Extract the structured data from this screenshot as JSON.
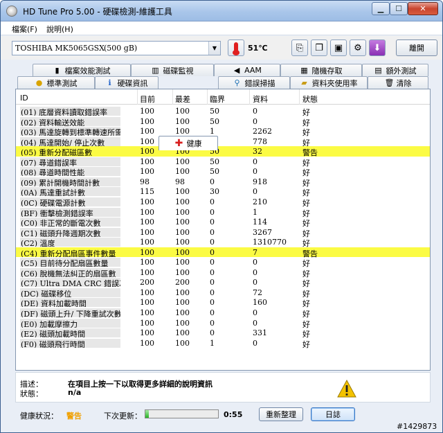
{
  "window": {
    "title": "HD Tune Pro  5.00 - 硬碟檢測-維護工具"
  },
  "menu": {
    "file": "檔案(F)",
    "help": "說明(H)"
  },
  "toolbar": {
    "drive_name": "TOSHIBA MK5065GSX",
    "drive_size": "(500 gB)",
    "temperature": "51℃",
    "exit_label": "離開"
  },
  "tabs_top": [
    {
      "label": "檔案效能測試",
      "icon": "file-benchmark-icon"
    },
    {
      "label": "磁碟監視",
      "icon": "disk-monitor-icon"
    },
    {
      "label": "AAM",
      "icon": "speaker-icon"
    },
    {
      "label": "隨機存取",
      "icon": "random-access-icon"
    },
    {
      "label": "額外測試",
      "icon": "extra-tests-icon"
    }
  ],
  "tabs_bottom": [
    {
      "label": "標準測試",
      "icon": "benchmark-icon"
    },
    {
      "label": "硬碟資訊",
      "icon": "info-icon"
    },
    {
      "label": "健康",
      "icon": "health-cross-icon"
    },
    {
      "label": "錯誤掃描",
      "icon": "error-scan-icon"
    },
    {
      "label": "資料夾使用率",
      "icon": "folder-usage-icon"
    },
    {
      "label": "清除",
      "icon": "erase-icon"
    }
  ],
  "grid": {
    "headers": [
      "ID",
      "目前",
      "最差",
      "臨界",
      "資料",
      "狀態"
    ],
    "rows": [
      {
        "id": "(01) 底層資料讀取錯誤率",
        "cur": "100",
        "worst": "100",
        "thr": "50",
        "data": "0",
        "status": "好"
      },
      {
        "id": "(02) 資料輸送效能",
        "cur": "100",
        "worst": "100",
        "thr": "50",
        "data": "0",
        "status": "好"
      },
      {
        "id": "(03) 馬達旋轉到標準轉速所需時...",
        "cur": "100",
        "worst": "100",
        "thr": "1",
        "data": "2262",
        "status": "好"
      },
      {
        "id": "(04) 馬達開始/ 停止次數",
        "cur": "100",
        "worst": "100",
        "thr": "0",
        "data": "778",
        "status": "好"
      },
      {
        "id": "(05) 重新分配磁區數",
        "cur": "100",
        "worst": "100",
        "thr": "50",
        "data": "32",
        "status": "警告",
        "warn": true
      },
      {
        "id": "(07) 尋道錯誤率",
        "cur": "100",
        "worst": "100",
        "thr": "50",
        "data": "0",
        "status": "好"
      },
      {
        "id": "(08) 尋道時間性能",
        "cur": "100",
        "worst": "100",
        "thr": "50",
        "data": "0",
        "status": "好"
      },
      {
        "id": "(09) 累計開機時間計數",
        "cur": "98",
        "worst": "98",
        "thr": "0",
        "data": "918",
        "status": "好"
      },
      {
        "id": "(0A) 馬達重試計數",
        "cur": "115",
        "worst": "100",
        "thr": "30",
        "data": "0",
        "status": "好"
      },
      {
        "id": "(0C) 硬碟電源計數",
        "cur": "100",
        "worst": "100",
        "thr": "0",
        "data": "210",
        "status": "好"
      },
      {
        "id": "(BF) 衝擊檢測錯誤率",
        "cur": "100",
        "worst": "100",
        "thr": "0",
        "data": "1",
        "status": "好"
      },
      {
        "id": "(C0) 非正常的斷電次數",
        "cur": "100",
        "worst": "100",
        "thr": "0",
        "data": "114",
        "status": "好"
      },
      {
        "id": "(C1) 磁頭升降週期次數",
        "cur": "100",
        "worst": "100",
        "thr": "0",
        "data": "3267",
        "status": "好"
      },
      {
        "id": "(C2) 溫度",
        "cur": "100",
        "worst": "100",
        "thr": "0",
        "data": "1310770",
        "status": "好"
      },
      {
        "id": "(C4) 重新分配扇區事件數量",
        "cur": "100",
        "worst": "100",
        "thr": "0",
        "data": "7",
        "status": "警告",
        "warn": true
      },
      {
        "id": "(C5) 目前待分配扇區數量",
        "cur": "100",
        "worst": "100",
        "thr": "0",
        "data": "0",
        "status": "好"
      },
      {
        "id": "(C6) 脫機無法糾正的扇區數",
        "cur": "100",
        "worst": "100",
        "thr": "0",
        "data": "0",
        "status": "好"
      },
      {
        "id": "(C7) Ultra DMA CRC 錯誤次數",
        "cur": "200",
        "worst": "200",
        "thr": "0",
        "data": "0",
        "status": "好"
      },
      {
        "id": "(DC) 磁碟移位",
        "cur": "100",
        "worst": "100",
        "thr": "0",
        "data": "72",
        "status": "好"
      },
      {
        "id": "(DE) 資料加載時間",
        "cur": "100",
        "worst": "100",
        "thr": "0",
        "data": "160",
        "status": "好"
      },
      {
        "id": "(DF) 磁頭上升/ 下降重試次數",
        "cur": "100",
        "worst": "100",
        "thr": "0",
        "data": "0",
        "status": "好"
      },
      {
        "id": "(E0) 加載摩擦力",
        "cur": "100",
        "worst": "100",
        "thr": "0",
        "data": "0",
        "status": "好"
      },
      {
        "id": "(E2) 磁頭加載時間",
        "cur": "100",
        "worst": "100",
        "thr": "0",
        "data": "331",
        "status": "好"
      },
      {
        "id": "(F0) 磁頭飛行時間",
        "cur": "100",
        "worst": "100",
        "thr": "1",
        "data": "0",
        "status": "好"
      }
    ]
  },
  "status": {
    "desc_label": "描述：",
    "desc_text": "在項目上按一下以取得更多詳細的說明資訊",
    "state_label": "狀態：",
    "state_text": "n/a"
  },
  "footer": {
    "health_label": "健康狀況：",
    "health_value": "警告",
    "next_label": "下次更新：",
    "progress": 0.05,
    "timer": "0:55",
    "refresh_label": "重新整理",
    "log_label": "日誌"
  },
  "watermark": "#1429873",
  "colors": {
    "warn_row": "#fbfb44",
    "health_warn": "#f0a000"
  }
}
